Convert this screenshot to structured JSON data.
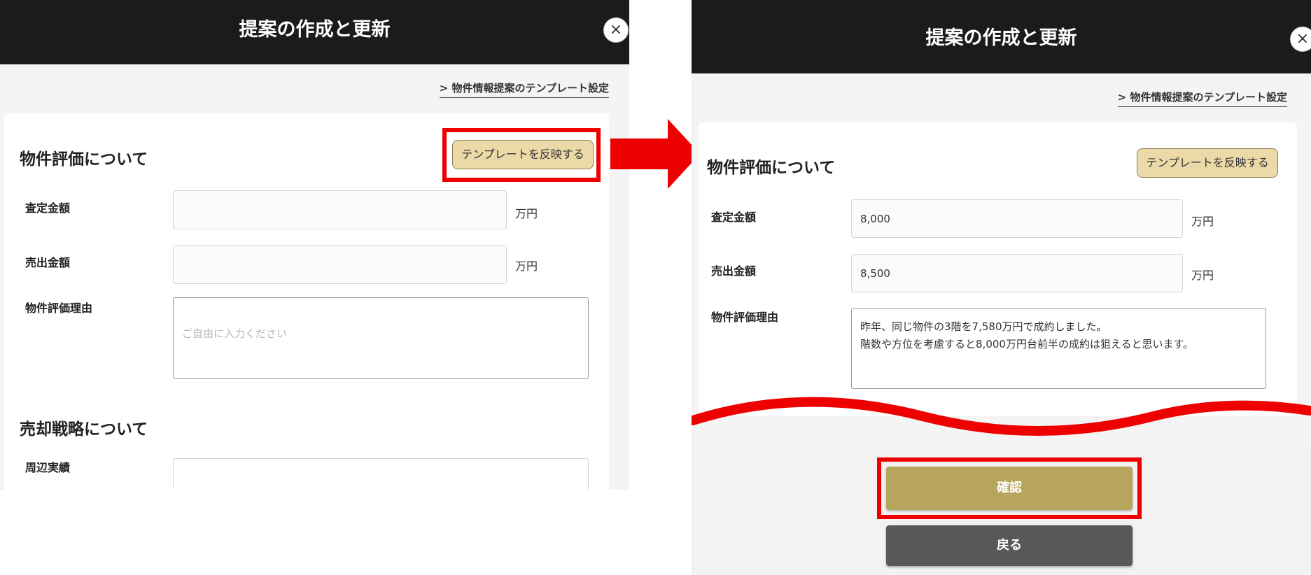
{
  "left": {
    "header_title": "提案の作成と更新",
    "close_glyph": "×",
    "template_link": "> 物件情報提案のテンプレート設定",
    "section1_title": "物件評価について",
    "apply_template_button": "テンプレートを反映する",
    "fields": {
      "assessed_label": "査定金額",
      "assessed_value": "",
      "assessed_unit": "万円",
      "sale_label": "売出金額",
      "sale_value": "",
      "sale_unit": "万円",
      "reason_label": "物件評価理由",
      "reason_placeholder": "ご自由に入力ください"
    },
    "section2_title": "売却戦略について",
    "nearby_label": "周辺実績"
  },
  "right": {
    "header_title": "提案の作成と更新",
    "template_link": "> 物件情報提案のテンプレート設定",
    "section1_title": "物件評価について",
    "apply_template_button": "テンプレートを反映する",
    "fields": {
      "assessed_label": "査定金額",
      "assessed_value": "8,000",
      "assessed_unit": "万円",
      "sale_label": "売出金額",
      "sale_value": "8,500",
      "sale_unit": "万円",
      "reason_label": "物件評価理由",
      "reason_value": "昨年、同じ物件の3階を7,580万円で成約しました。\n階数や方位を考慮すると8,000万円台前半の成約は狙えると思います。"
    },
    "confirm_button": "確認",
    "back_button": "戻る"
  },
  "colors": {
    "header_bg": "#1b1b1b",
    "highlight_red": "#ee0000",
    "template_button_bg": "#ecd9a8",
    "confirm_button_bg": "#b7a55b",
    "back_button_bg": "#585858"
  },
  "icons": {
    "close": "close-icon",
    "arrow": "right-arrow-icon"
  }
}
